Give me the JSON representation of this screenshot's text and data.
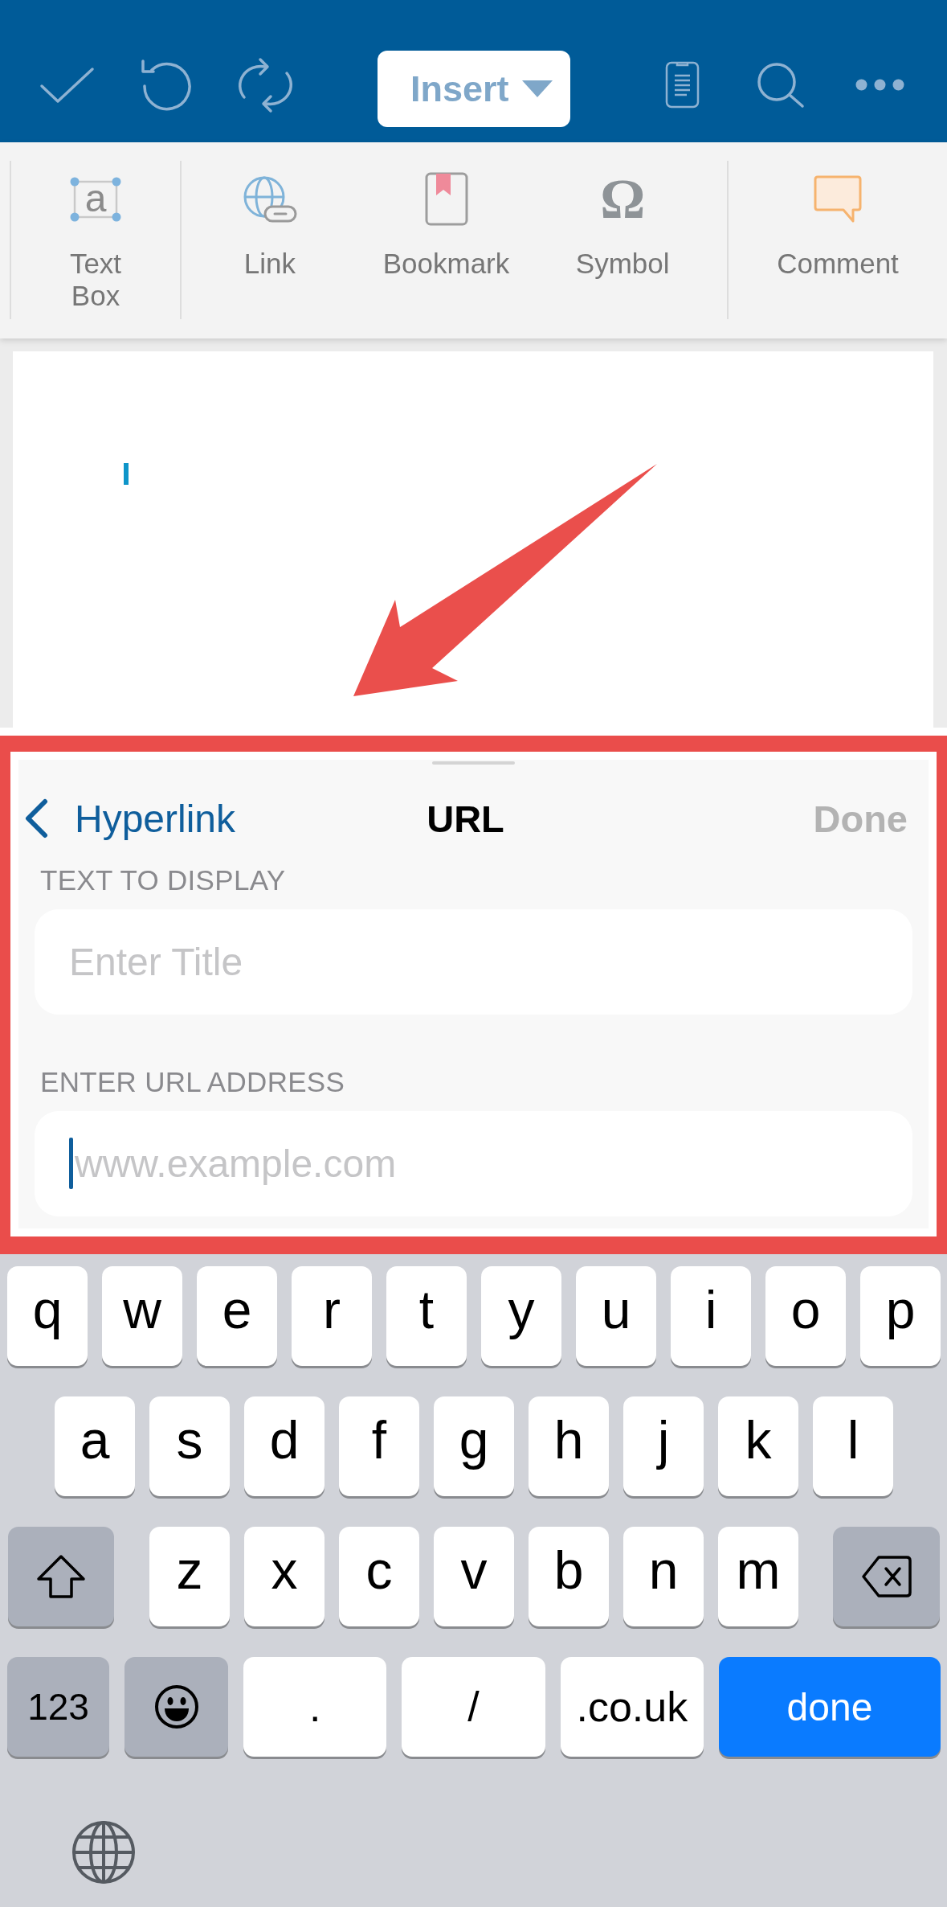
{
  "top_bar": {
    "menu_button": {
      "label": "Insert"
    }
  },
  "ribbon": {
    "groups": [
      {
        "items": [
          {
            "kind": "textbox",
            "label": "Text Box",
            "glyph": "a"
          }
        ]
      },
      {
        "items": [
          {
            "kind": "link",
            "label": "Link"
          },
          {
            "kind": "bookmark",
            "label": "Bookmark"
          },
          {
            "kind": "symbol",
            "label": "Symbol",
            "glyph": "Ω"
          }
        ]
      },
      {
        "items": [
          {
            "kind": "comment",
            "label": "Comment"
          }
        ]
      }
    ]
  },
  "hyperlink_panel": {
    "back_button": {
      "label": "Hyperlink"
    },
    "title": "URL",
    "done_button": {
      "label": "Done",
      "disabled": true
    },
    "fields": [
      {
        "label": "TEXT TO DISPLAY",
        "placeholder": "Enter Title",
        "focused": false
      },
      {
        "label": "ENTER URL ADDRESS",
        "placeholder": "www.example.com",
        "focused": true
      }
    ]
  },
  "keyboard": {
    "rows": [
      {
        "keys": [
          {
            "kind": "letter",
            "label": "q"
          },
          {
            "kind": "letter",
            "label": "w"
          },
          {
            "kind": "letter",
            "label": "e"
          },
          {
            "kind": "letter",
            "label": "r"
          },
          {
            "kind": "letter",
            "label": "t"
          },
          {
            "kind": "letter",
            "label": "y"
          },
          {
            "kind": "letter",
            "label": "u"
          },
          {
            "kind": "letter",
            "label": "i"
          },
          {
            "kind": "letter",
            "label": "o"
          },
          {
            "kind": "letter",
            "label": "p"
          }
        ]
      },
      {
        "keys": [
          {
            "kind": "letter",
            "label": "a"
          },
          {
            "kind": "letter",
            "label": "s"
          },
          {
            "kind": "letter",
            "label": "d"
          },
          {
            "kind": "letter",
            "label": "f"
          },
          {
            "kind": "letter",
            "label": "g"
          },
          {
            "kind": "letter",
            "label": "h"
          },
          {
            "kind": "letter",
            "label": "j"
          },
          {
            "kind": "letter",
            "label": "k"
          },
          {
            "kind": "letter",
            "label": "l"
          }
        ]
      },
      {
        "keys": [
          {
            "kind": "shift"
          },
          {
            "kind": "letter",
            "label": "z"
          },
          {
            "kind": "letter",
            "label": "x"
          },
          {
            "kind": "letter",
            "label": "c"
          },
          {
            "kind": "letter",
            "label": "v"
          },
          {
            "kind": "letter",
            "label": "b"
          },
          {
            "kind": "letter",
            "label": "n"
          },
          {
            "kind": "letter",
            "label": "m"
          },
          {
            "kind": "delete"
          }
        ]
      },
      {
        "keys": [
          {
            "kind": "mode",
            "label": "123"
          },
          {
            "kind": "emoji"
          },
          {
            "kind": "punct",
            "label": "."
          },
          {
            "kind": "punct",
            "label": "/"
          },
          {
            "kind": "punct",
            "label": ".co.uk"
          },
          {
            "kind": "return",
            "label": "done"
          }
        ]
      }
    ],
    "bottom_keys": [
      {
        "kind": "globe"
      }
    ]
  }
}
